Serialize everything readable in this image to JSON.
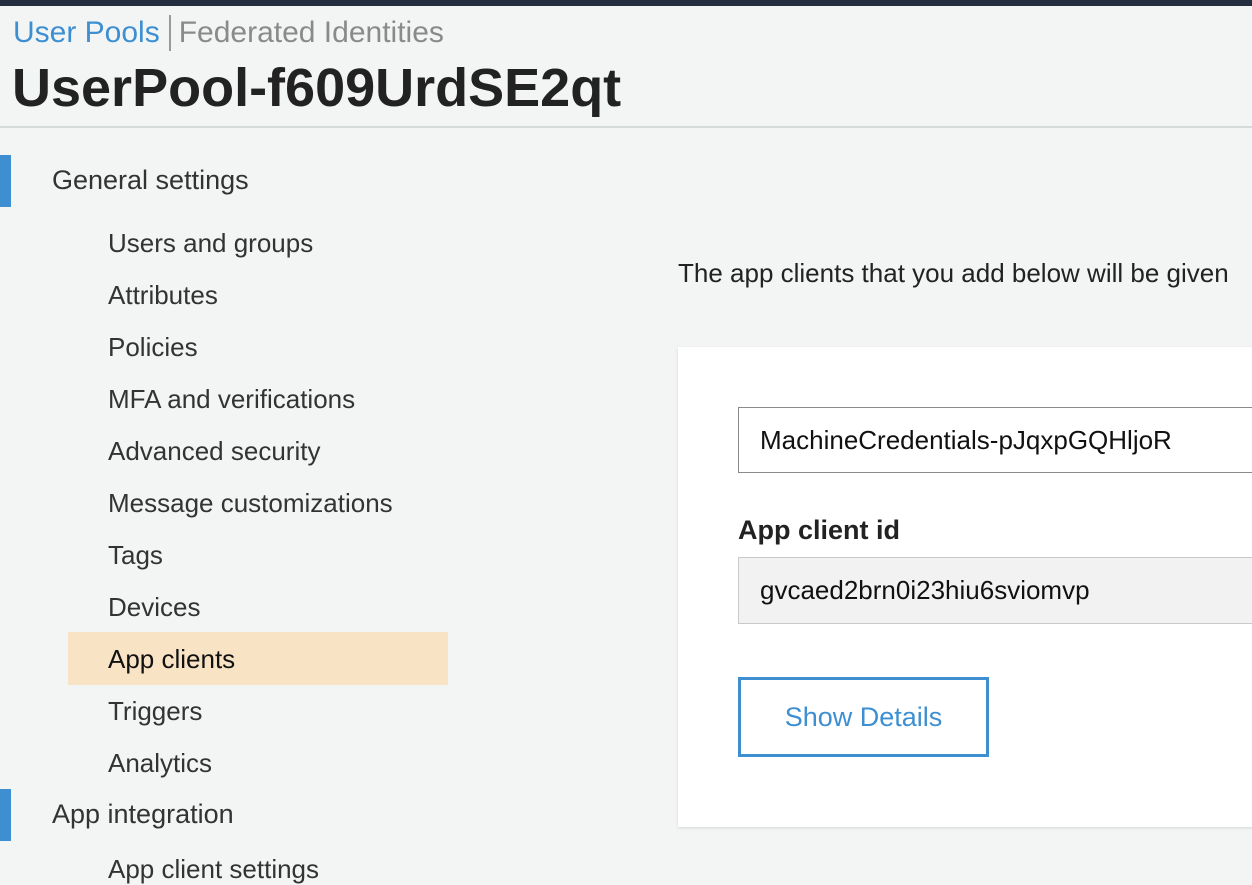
{
  "header": {
    "tabs": [
      "User Pools",
      "Federated Identities"
    ],
    "title": "UserPool-f609UrdSE2qt"
  },
  "sidebar": {
    "general_settings": {
      "label": "General settings",
      "items": [
        "Users and groups",
        "Attributes",
        "Policies",
        "MFA and verifications",
        "Advanced security",
        "Message customizations",
        "Tags",
        "Devices",
        "App clients",
        "Triggers",
        "Analytics"
      ],
      "selected": "App clients"
    },
    "app_integration": {
      "label": "App integration",
      "partial_item": "App client settings"
    }
  },
  "main": {
    "intro": "The app clients that you add below will be given",
    "client": {
      "name_value": "MachineCredentials-pJqxpGQHljoR",
      "id_label": "App client id",
      "id_value": "gvcaed2brn0i23hiu6sviomvp",
      "show_details_label": "Show Details"
    }
  },
  "colors": {
    "accent": "#3d8fd1",
    "selected_bg": "#f9e3c5",
    "topbar": "#232f3e"
  }
}
